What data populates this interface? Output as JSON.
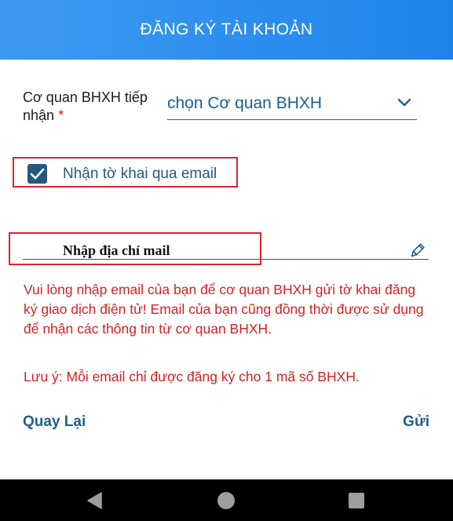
{
  "header": {
    "title": "ĐĂNG KÝ TÀI KHOẢN"
  },
  "form": {
    "agency_label": "Cơ quan BHXH tiếp nhận",
    "required_mark": "*",
    "agency_select_value": "chọn Cơ quan BHXH",
    "email_checkbox_label": "Nhận tờ khai qua email",
    "email_checkbox_checked": true,
    "email_placeholder": "Nhập địa chỉ mail",
    "info_text": "Vui lòng nhập email của bạn để cơ quan BHXH gửi tờ khai đăng ký giao dịch điện tử! Email của bạn cũng đồng thời được sử dụng để nhận các thông tin từ cơ quan BHXH.",
    "note_text": "Lưu ý: Mỗi email chỉ được đăng ký cho 1 mã số BHXH."
  },
  "actions": {
    "back_label": "Quay Lại",
    "send_label": "Gửi"
  },
  "icons": {
    "select": "chevron-down-icon",
    "edit": "pencil-icon",
    "nav": [
      "back-triangle-icon",
      "home-circle-icon",
      "recents-square-icon"
    ]
  },
  "colors": {
    "header_gradient": [
      "#3d9af0",
      "#1e84ec"
    ],
    "primary_text": "#1b5f92",
    "warning_text": "#d22222",
    "highlight_box": "#d92631",
    "checkbox_fill": "#26587e",
    "navbar": "#000000"
  }
}
